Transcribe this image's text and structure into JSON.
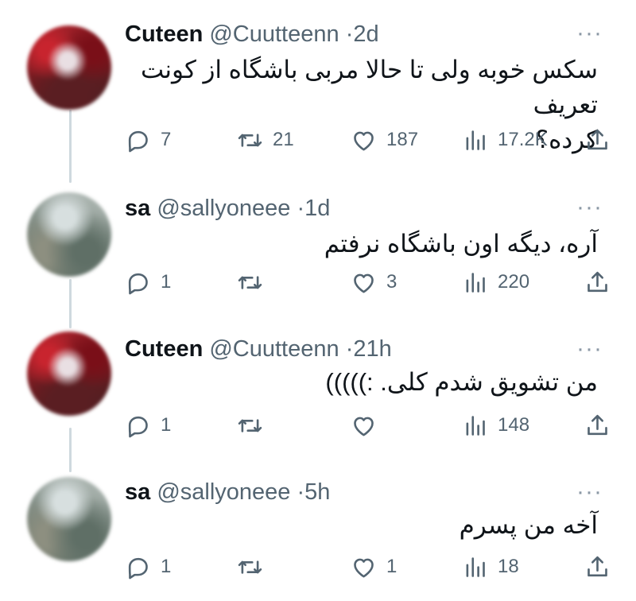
{
  "tweets": [
    {
      "name": "Cuteen",
      "handle": "@Cuutteenn",
      "time": "2d",
      "text_line1": "سکس خوبه ولی تا حالا مربی باشگاه از کونت تعریف",
      "text_line2": "کرده؟",
      "replies": "7",
      "retweets": "21",
      "likes": "187",
      "views": "17.2K"
    },
    {
      "name": "sa",
      "handle": "@sallyoneee",
      "time": "1d",
      "text_line1": "آره، دیگه اون باشگاه نرفتم",
      "replies": "1",
      "retweets": "",
      "likes": "3",
      "views": "220"
    },
    {
      "name": "Cuteen",
      "handle": "@Cuutteenn",
      "time": "21h",
      "text_line1": "من تشویق شدم کلی. :)))))",
      "replies": "1",
      "retweets": "",
      "likes": "",
      "views": "148"
    },
    {
      "name": "sa",
      "handle": "@sallyoneee",
      "time": "5h",
      "text_line1": "آخه من پسرم",
      "replies": "1",
      "retweets": "",
      "likes": "1",
      "views": "18"
    }
  ],
  "separator": "·",
  "more_label": "···",
  "colors": {
    "text": "#0f1419",
    "secondary": "#536471",
    "thread_line": "#cfd9de"
  },
  "icons": [
    "reply-icon",
    "retweet-icon",
    "like-icon",
    "views-icon",
    "share-icon",
    "more-icon"
  ]
}
